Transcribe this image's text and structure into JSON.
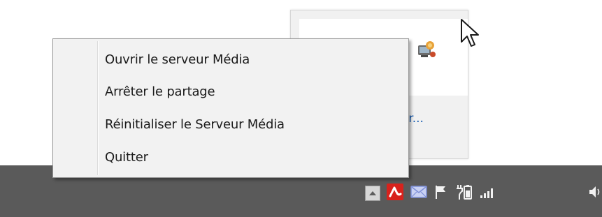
{
  "flyout": {
    "link_text": "ser..."
  },
  "context_menu": {
    "items": [
      {
        "label": "Ouvrir le serveur Média"
      },
      {
        "label": "Arrêter le partage"
      },
      {
        "label": "Réinitialiser le Serveur Média"
      },
      {
        "label": "Quitter"
      }
    ]
  },
  "taskbar": {
    "tray_icons": [
      "show-hidden-icons-icon",
      "avira-icon",
      "mail-icon",
      "action-center-flag-icon",
      "power-battery-icon",
      "network-signal-icon",
      "volume-icon"
    ]
  },
  "colors": {
    "taskbar": "#5a5a5a",
    "menu_background": "#f2f2f2",
    "menu_border": "#979797",
    "link": "#1a5fb4",
    "avira_red": "#d8221c",
    "mail_blue": "#7e8fd8"
  }
}
